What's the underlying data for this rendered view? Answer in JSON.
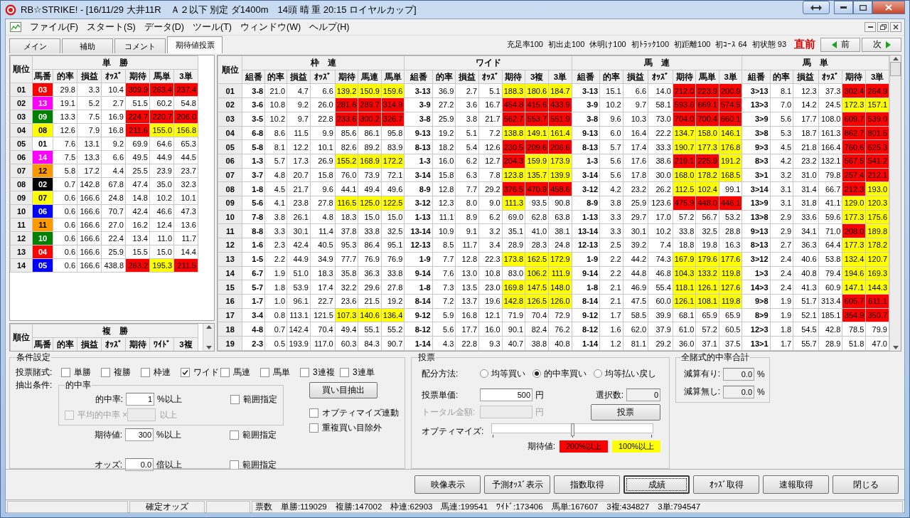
{
  "window": {
    "title": "RB☆STRIKE! - [16/11/29 大井11R　Ａ２以下 別定 ダ1400m　14頭 晴 重 20:15 ロイヤルカップ]"
  },
  "menu": [
    "ファイル(F)",
    "スタート(S)",
    "データ(D)",
    "ツール(T)",
    "ウィンドウ(W)",
    "ヘルプ(H)"
  ],
  "tabs": [
    {
      "label": "メイン",
      "selected": false
    },
    {
      "label": "補助",
      "selected": false
    },
    {
      "label": "コメント",
      "selected": false
    },
    {
      "label": "期待値投票",
      "selected": true
    }
  ],
  "stats": [
    "充足率100",
    "初出走100",
    "休明け100",
    "初ﾄﾗｯｸ100",
    "初距離100",
    "初ｺｰｽ 64",
    "初状態 93"
  ],
  "timing": "直前",
  "nav": {
    "prev": "前",
    "next": "次"
  },
  "win_table": {
    "rank_header": "順位",
    "title": "単　勝",
    "columns": [
      "馬番",
      "的率",
      "損益",
      "ｵｯｽﾞ",
      "期待",
      "馬単",
      "3単"
    ],
    "rows": [
      {
        "rank": "01",
        "cells": [
          {
            "text": "03",
            "color": "#ff0000"
          },
          "29.8",
          "3.3",
          "10.4",
          {
            "text": "309.9",
            "color": "#ff0000"
          },
          {
            "text": "263.4",
            "color": "#ff0000"
          },
          {
            "text": "237.4",
            "color": "#ff0000"
          }
        ]
      },
      {
        "rank": "02",
        "cells": [
          {
            "text": "13",
            "color": "#ff00ff"
          },
          "19.1",
          "5.2",
          "2.7",
          "51.5",
          "60.2",
          "54.8"
        ]
      },
      {
        "rank": "03",
        "cells": [
          {
            "text": "09",
            "color": "#008000"
          },
          "13.3",
          "7.5",
          "16.9",
          {
            "text": "224.7",
            "color": "#ff0000"
          },
          {
            "text": "220.7",
            "color": "#ff0000"
          },
          {
            "text": "206.0",
            "color": "#ff0000"
          }
        ]
      },
      {
        "rank": "04",
        "cells": [
          {
            "text": "08",
            "color": "#ffff00"
          },
          "12.6",
          "7.9",
          "16.8",
          {
            "text": "211.6",
            "color": "#ff0000"
          },
          {
            "text": "155.0",
            "color": "#ffff00"
          },
          {
            "text": "156.8",
            "color": "#ffff00"
          }
        ]
      },
      {
        "rank": "05",
        "cells": [
          {
            "text": "01",
            "color": "#ffffff"
          },
          "7.6",
          "13.1",
          "9.2",
          "69.9",
          "64.6",
          "65.3"
        ]
      },
      {
        "rank": "06",
        "cells": [
          {
            "text": "14",
            "color": "#ff00ff"
          },
          "7.5",
          "13.3",
          "6.6",
          "49.5",
          "44.9",
          "44.5"
        ]
      },
      {
        "rank": "07",
        "cells": [
          {
            "text": "12",
            "color": "#ff9900"
          },
          "5.8",
          "17.2",
          "4.4",
          "25.5",
          "23.9",
          "23.7"
        ]
      },
      {
        "rank": "08",
        "cells": [
          {
            "text": "02",
            "color": "#000000"
          },
          "0.7",
          "142.8",
          "67.8",
          "47.4",
          "35.0",
          "32.3"
        ]
      },
      {
        "rank": "09",
        "cells": [
          {
            "text": "07",
            "color": "#ffff00"
          },
          "0.6",
          "166.6",
          "24.8",
          "14.8",
          "10.2",
          "10.1"
        ]
      },
      {
        "rank": "10",
        "cells": [
          {
            "text": "06",
            "color": "#0000ff"
          },
          "0.6",
          "166.6",
          "70.7",
          "42.4",
          "46.6",
          "47.3"
        ]
      },
      {
        "rank": "11",
        "cells": [
          {
            "text": "11",
            "color": "#ff9900"
          },
          "0.6",
          "166.6",
          "27.0",
          "16.2",
          "12.4",
          "13.6"
        ]
      },
      {
        "rank": "12",
        "cells": [
          {
            "text": "10",
            "color": "#008000"
          },
          "0.6",
          "166.6",
          "22.4",
          "13.4",
          "11.0",
          "11.7"
        ]
      },
      {
        "rank": "13",
        "cells": [
          {
            "text": "04",
            "color": "#ff0000"
          },
          "0.6",
          "166.6",
          "25.9",
          "15.5",
          "15.0",
          "14.4"
        ]
      },
      {
        "rank": "14",
        "cells": [
          {
            "text": "05",
            "color": "#0000ff"
          },
          "0.6",
          "166.6",
          "438.8",
          {
            "text": "263.2",
            "color": "#ff0000"
          },
          {
            "text": "195.3",
            "color": "#ffff00"
          },
          {
            "text": "211.5",
            "color": "#ff0000"
          }
        ]
      }
    ]
  },
  "place_table": {
    "rank_header": "順位",
    "title": "複　勝",
    "columns": [
      "馬番",
      "的率",
      "損益",
      "ｵｯｽﾞ",
      "期待",
      "ﾜｲﾄﾞ",
      "3複"
    ]
  },
  "main_table": {
    "rank_header": "順位",
    "groups": [
      {
        "title": "枠　連",
        "columns": [
          "組番",
          "的率",
          "損益",
          "ｵｯｽﾞ",
          "期待",
          "馬連",
          "馬単"
        ]
      },
      {
        "title": "ワイド",
        "columns": [
          "組番",
          "的率",
          "損益",
          "ｵｯｽﾞ",
          "期待",
          "3複",
          "3単"
        ]
      },
      {
        "title": "馬　連",
        "columns": [
          "組番",
          "的率",
          "損益",
          "ｵｯｽﾞ",
          "期待",
          "馬単",
          "3単"
        ]
      },
      {
        "title": "馬　単",
        "columns": [
          "組番",
          "的率",
          "損益",
          "ｵｯｽﾞ",
          "期待",
          "3単"
        ]
      }
    ],
    "rows": [
      {
        "rank": "01",
        "cells": [
          "3-8",
          "21.0",
          "4.7",
          "6.6",
          {
            "text": "139.2",
            "color": "#ffff00"
          },
          {
            "text": "150.9",
            "color": "#ffff00"
          },
          {
            "text": "159.6",
            "color": "#ffff00"
          },
          "3-13",
          "36.9",
          "2.7",
          "5.1",
          {
            "text": "188.3",
            "color": "#ffff00"
          },
          {
            "text": "180.6",
            "color": "#ffff00"
          },
          {
            "text": "184.7",
            "color": "#ffff00"
          },
          "3-13",
          "15.1",
          "6.6",
          "14.0",
          {
            "text": "212.0",
            "color": "#ff0000"
          },
          {
            "text": "223.9",
            "color": "#ff0000"
          },
          {
            "text": "200.9",
            "color": "#ff0000"
          },
          "3>13",
          "8.1",
          "12.3",
          "37.3",
          {
            "text": "302.4",
            "color": "#ff0000"
          },
          {
            "text": "264.9",
            "color": "#ff0000"
          }
        ]
      },
      {
        "rank": "02",
        "cells": [
          "3-6",
          "10.8",
          "9.2",
          "26.0",
          {
            "text": "281.6",
            "color": "#ff0000"
          },
          {
            "text": "289.7",
            "color": "#ff0000"
          },
          {
            "text": "314.9",
            "color": "#ff0000"
          },
          "3-9",
          "27.2",
          "3.6",
          "16.7",
          {
            "text": "454.8",
            "color": "#ff0000"
          },
          {
            "text": "415.6",
            "color": "#ff0000"
          },
          {
            "text": "433.9",
            "color": "#ff0000"
          },
          "3-9",
          "10.2",
          "9.7",
          "58.1",
          {
            "text": "593.6",
            "color": "#ff0000"
          },
          {
            "text": "669.1",
            "color": "#ff0000"
          },
          {
            "text": "574.5",
            "color": "#ff0000"
          },
          "13>3",
          "7.0",
          "14.2",
          "24.5",
          {
            "text": "172.3",
            "color": "#ffff00"
          },
          {
            "text": "157.1",
            "color": "#ffff00"
          }
        ]
      },
      {
        "rank": "03",
        "cells": [
          "3-5",
          "10.2",
          "9.7",
          "22.8",
          {
            "text": "233.6",
            "color": "#ff0000"
          },
          {
            "text": "300.2",
            "color": "#ff0000"
          },
          {
            "text": "326.7",
            "color": "#ff0000"
          },
          "3-8",
          "25.9",
          "3.8",
          "21.7",
          {
            "text": "562.7",
            "color": "#ff0000"
          },
          {
            "text": "553.7",
            "color": "#ff0000"
          },
          {
            "text": "551.9",
            "color": "#ff0000"
          },
          "3-8",
          "9.6",
          "10.3",
          "73.0",
          {
            "text": "704.0",
            "color": "#ff0000"
          },
          {
            "text": "700.4",
            "color": "#ff0000"
          },
          {
            "text": "660.1",
            "color": "#ff0000"
          },
          "3>9",
          "5.6",
          "17.7",
          "108.0",
          {
            "text": "609.7",
            "color": "#ff0000"
          },
          {
            "text": "539.0",
            "color": "#ff0000"
          }
        ]
      },
      {
        "rank": "04",
        "cells": [
          "6-8",
          "8.6",
          "11.5",
          "9.9",
          "85.6",
          "86.1",
          "95.8",
          "9-13",
          "19.2",
          "5.1",
          "7.2",
          {
            "text": "138.8",
            "color": "#ffff00"
          },
          {
            "text": "149.1",
            "color": "#ffff00"
          },
          {
            "text": "161.4",
            "color": "#ffff00"
          },
          "9-13",
          "6.0",
          "16.4",
          "22.2",
          {
            "text": "134.7",
            "color": "#ffff00"
          },
          {
            "text": "158.0",
            "color": "#ffff00"
          },
          {
            "text": "146.1",
            "color": "#ffff00"
          },
          "3>8",
          "5.3",
          "18.7",
          "161.3",
          {
            "text": "862.7",
            "color": "#ff0000"
          },
          {
            "text": "801.5",
            "color": "#ff0000"
          }
        ]
      },
      {
        "rank": "05",
        "cells": [
          "5-8",
          "8.1",
          "12.2",
          "10.1",
          "82.6",
          "89.2",
          "83.9",
          "8-13",
          "18.2",
          "5.4",
          "12.6",
          {
            "text": "230.5",
            "color": "#ff0000"
          },
          {
            "text": "209.6",
            "color": "#ff0000"
          },
          {
            "text": "206.6",
            "color": "#ff0000"
          },
          "8-13",
          "5.7",
          "17.4",
          "33.3",
          {
            "text": "190.7",
            "color": "#ffff00"
          },
          {
            "text": "177.3",
            "color": "#ffff00"
          },
          {
            "text": "176.8",
            "color": "#ffff00"
          },
          "9>3",
          "4.5",
          "21.8",
          "166.4",
          {
            "text": "760.6",
            "color": "#ff0000"
          },
          {
            "text": "625.3",
            "color": "#ff0000"
          }
        ]
      },
      {
        "rank": "06",
        "cells": [
          "1-3",
          "5.7",
          "17.3",
          "26.9",
          {
            "text": "155.2",
            "color": "#ffff00"
          },
          {
            "text": "168.9",
            "color": "#ffff00"
          },
          {
            "text": "172.2",
            "color": "#ffff00"
          },
          "1-3",
          "16.0",
          "6.2",
          "12.7",
          {
            "text": "204.3",
            "color": "#ff0000"
          },
          {
            "text": "159.9",
            "color": "#ffff00"
          },
          {
            "text": "173.9",
            "color": "#ffff00"
          },
          "1-3",
          "5.6",
          "17.6",
          "38.6",
          {
            "text": "219.1",
            "color": "#ff0000"
          },
          {
            "text": "225.9",
            "color": "#ff0000"
          },
          {
            "text": "191.2",
            "color": "#ffff00"
          },
          "8>3",
          "4.2",
          "23.2",
          "132.1",
          {
            "text": "567.5",
            "color": "#ff0000"
          },
          {
            "text": "541.2",
            "color": "#ff0000"
          }
        ]
      },
      {
        "rank": "07",
        "cells": [
          "3-7",
          "4.8",
          "20.7",
          "15.8",
          "76.0",
          "73.9",
          "72.1",
          "3-14",
          "15.8",
          "6.3",
          "7.8",
          {
            "text": "123.8",
            "color": "#ffff00"
          },
          {
            "text": "135.7",
            "color": "#ffff00"
          },
          {
            "text": "139.9",
            "color": "#ffff00"
          },
          "3-14",
          "5.6",
          "17.8",
          "30.0",
          {
            "text": "168.0",
            "color": "#ffff00"
          },
          {
            "text": "178.2",
            "color": "#ffff00"
          },
          {
            "text": "168.5",
            "color": "#ffff00"
          },
          "3>1",
          "3.2",
          "31.0",
          "79.8",
          {
            "text": "257.4",
            "color": "#ff0000"
          },
          {
            "text": "212.1",
            "color": "#ff0000"
          }
        ]
      },
      {
        "rank": "08",
        "cells": [
          "1-8",
          "4.5",
          "21.7",
          "9.6",
          "44.1",
          "49.4",
          "49.6",
          "8-9",
          "12.8",
          "7.7",
          "29.2",
          {
            "text": "376.5",
            "color": "#ff0000"
          },
          {
            "text": "470.9",
            "color": "#ff0000"
          },
          {
            "text": "458.6",
            "color": "#ff0000"
          },
          "3-12",
          "4.2",
          "23.2",
          "26.2",
          {
            "text": "112.5",
            "color": "#ffff00"
          },
          {
            "text": "102.4",
            "color": "#ffff00"
          },
          "99.1",
          "3>14",
          "3.1",
          "31.4",
          "66.7",
          {
            "text": "212.3",
            "color": "#ff0000"
          },
          {
            "text": "193.0",
            "color": "#ffff00"
          }
        ]
      },
      {
        "rank": "09",
        "cells": [
          "5-6",
          "4.1",
          "23.8",
          "27.8",
          {
            "text": "116.5",
            "color": "#ffff00"
          },
          {
            "text": "125.0",
            "color": "#ffff00"
          },
          {
            "text": "122.5",
            "color": "#ffff00"
          },
          "3-12",
          "12.3",
          "8.0",
          "9.0",
          {
            "text": "111.3",
            "color": "#ffff00"
          },
          "93.5",
          "90.8",
          "8-9",
          "3.8",
          "25.9",
          "123.6",
          {
            "text": "475.9",
            "color": "#ff0000"
          },
          {
            "text": "448.0",
            "color": "#ff0000"
          },
          {
            "text": "446.1",
            "color": "#ff0000"
          },
          "13>9",
          "3.1",
          "31.8",
          "41.1",
          {
            "text": "129.0",
            "color": "#ffff00"
          },
          {
            "text": "120.3",
            "color": "#ffff00"
          }
        ]
      },
      {
        "rank": "10",
        "cells": [
          "7-8",
          "3.8",
          "26.1",
          "4.8",
          "18.3",
          "15.0",
          "15.0",
          "1-13",
          "11.1",
          "8.9",
          "6.2",
          "69.0",
          "62.8",
          "63.8",
          "1-13",
          "3.3",
          "29.7",
          "17.0",
          "57.2",
          "56.7",
          "53.2",
          "13>8",
          "2.9",
          "33.6",
          "59.6",
          {
            "text": "177.3",
            "color": "#ffff00"
          },
          {
            "text": "175.6",
            "color": "#ffff00"
          }
        ]
      },
      {
        "rank": "11",
        "cells": [
          "8-8",
          "3.3",
          "30.1",
          "11.4",
          "37.8",
          "33.8",
          "32.5",
          "13-14",
          "10.9",
          "9.1",
          "3.2",
          "35.1",
          "41.0",
          "38.1",
          "13-14",
          "3.3",
          "30.1",
          "10.2",
          "33.8",
          "32.5",
          "28.8",
          "9>13",
          "2.9",
          "34.1",
          "71.0",
          {
            "text": "208.0",
            "color": "#ff0000"
          },
          {
            "text": "189.8",
            "color": "#ffff00"
          }
        ]
      },
      {
        "rank": "12",
        "cells": [
          "1-6",
          "2.3",
          "42.4",
          "40.5",
          "95.3",
          "86.4",
          "95.1",
          "12-13",
          "8.5",
          "11.7",
          "3.4",
          "28.9",
          "28.3",
          "24.8",
          "12-13",
          "2.5",
          "39.2",
          "7.4",
          "18.8",
          "19.8",
          "16.3",
          "8>13",
          "2.7",
          "36.3",
          "64.4",
          {
            "text": "177.3",
            "color": "#ffff00"
          },
          {
            "text": "178.2",
            "color": "#ffff00"
          }
        ]
      },
      {
        "rank": "13",
        "cells": [
          "1-5",
          "2.2",
          "44.9",
          "34.9",
          "77.7",
          "76.9",
          "76.9",
          "1-9",
          "7.7",
          "12.8",
          "22.3",
          {
            "text": "173.8",
            "color": "#ffff00"
          },
          {
            "text": "162.5",
            "color": "#ffff00"
          },
          {
            "text": "172.9",
            "color": "#ffff00"
          },
          "1-9",
          "2.2",
          "44.2",
          "74.3",
          {
            "text": "167.9",
            "color": "#ffff00"
          },
          {
            "text": "179.6",
            "color": "#ffff00"
          },
          {
            "text": "177.6",
            "color": "#ffff00"
          },
          "3>12",
          "2.4",
          "40.6",
          "53.8",
          {
            "text": "132.4",
            "color": "#ffff00"
          },
          {
            "text": "120.7",
            "color": "#ffff00"
          }
        ]
      },
      {
        "rank": "14",
        "cells": [
          "6-7",
          "1.9",
          "51.0",
          "18.3",
          "35.8",
          "36.3",
          "33.8",
          "9-14",
          "7.6",
          "13.0",
          "10.8",
          "83.0",
          {
            "text": "106.2",
            "color": "#ffff00"
          },
          {
            "text": "111.9",
            "color": "#ffff00"
          },
          "9-14",
          "2.2",
          "44.8",
          "46.8",
          {
            "text": "104.3",
            "color": "#ffff00"
          },
          {
            "text": "133.2",
            "color": "#ffff00"
          },
          {
            "text": "119.8",
            "color": "#ffff00"
          },
          "1>3",
          "2.4",
          "40.8",
          "79.4",
          {
            "text": "194.6",
            "color": "#ffff00"
          },
          {
            "text": "169.3",
            "color": "#ffff00"
          }
        ]
      },
      {
        "rank": "15",
        "cells": [
          "5-7",
          "1.8",
          "53.9",
          "17.4",
          "32.2",
          "29.6",
          "27.8",
          "1-8",
          "7.3",
          "13.5",
          "23.0",
          {
            "text": "169.8",
            "color": "#ffff00"
          },
          {
            "text": "147.5",
            "color": "#ffff00"
          },
          {
            "text": "148.0",
            "color": "#ffff00"
          },
          "1-8",
          "2.1",
          "46.9",
          "55.4",
          {
            "text": "118.1",
            "color": "#ffff00"
          },
          {
            "text": "126.1",
            "color": "#ffff00"
          },
          {
            "text": "127.6",
            "color": "#ffff00"
          },
          "14>3",
          "2.4",
          "41.3",
          "60.9",
          {
            "text": "147.1",
            "color": "#ffff00"
          },
          {
            "text": "144.3",
            "color": "#ffff00"
          }
        ]
      },
      {
        "rank": "16",
        "cells": [
          "1-7",
          "1.0",
          "96.1",
          "22.7",
          "23.6",
          "21.5",
          "19.2",
          "8-14",
          "7.2",
          "13.7",
          "19.6",
          {
            "text": "142.8",
            "color": "#ffff00"
          },
          {
            "text": "126.5",
            "color": "#ffff00"
          },
          {
            "text": "126.0",
            "color": "#ffff00"
          },
          "8-14",
          "2.1",
          "47.5",
          "60.0",
          {
            "text": "126.1",
            "color": "#ffff00"
          },
          {
            "text": "108.1",
            "color": "#ffff00"
          },
          {
            "text": "119.8",
            "color": "#ffff00"
          },
          "9>8",
          "1.9",
          "51.7",
          "313.4",
          {
            "text": "605.7",
            "color": "#ff0000"
          },
          {
            "text": "611.1",
            "color": "#ff0000"
          }
        ]
      },
      {
        "rank": "17",
        "cells": [
          "3-4",
          "0.8",
          "113.1",
          "121.5",
          {
            "text": "107.3",
            "color": "#ffff00"
          },
          {
            "text": "140.6",
            "color": "#ffff00"
          },
          {
            "text": "136.4",
            "color": "#ffff00"
          },
          "9-12",
          "5.9",
          "16.8",
          "12.1",
          "71.9",
          "70.4",
          "72.9",
          "9-12",
          "1.7",
          "58.5",
          "39.9",
          "68.1",
          "65.9",
          "65.9",
          "8>9",
          "1.9",
          "52.1",
          "185.1",
          {
            "text": "354.9",
            "color": "#ff0000"
          },
          {
            "text": "350.7",
            "color": "#ff0000"
          }
        ]
      },
      {
        "rank": "18",
        "cells": [
          "4-8",
          "0.7",
          "142.4",
          "70.4",
          "49.4",
          "55.1",
          "55.2",
          "8-12",
          "5.6",
          "17.7",
          "16.0",
          "90.1",
          "82.4",
          "76.2",
          "8-12",
          "1.6",
          "62.0",
          "37.9",
          "61.0",
          "57.2",
          "60.5",
          "12>3",
          "1.8",
          "54.5",
          "42.8",
          "78.5",
          "79.9"
        ]
      },
      {
        "rank": "19",
        "cells": [
          "2-3",
          "0.5",
          "193.9",
          "117.0",
          "60.3",
          "84.3",
          "90.7",
          "1-14",
          "4.3",
          "22.8",
          "9.3",
          "40.7",
          "38.8",
          "40.8",
          "1-14",
          "1.2",
          "81.1",
          "29.2",
          "36.0",
          "37.1",
          "37.5",
          "13>1",
          "1.7",
          "55.7",
          "28.9",
          "51.8",
          "47.0"
        ]
      }
    ]
  },
  "conditions": {
    "title": "条件設定",
    "bet_label": "投票賭式:",
    "bet_types": [
      {
        "label": "単勝",
        "checked": false
      },
      {
        "label": "複勝",
        "checked": false
      },
      {
        "label": "枠連",
        "checked": false
      },
      {
        "label": "ワイド",
        "checked": true
      },
      {
        "label": "馬連",
        "checked": false
      },
      {
        "label": "馬単",
        "checked": false
      },
      {
        "label": "3連複",
        "checked": false
      },
      {
        "label": "3連単",
        "checked": false
      }
    ],
    "extract_label": "抽出条件:",
    "hit_group": {
      "title": "的中率",
      "field": {
        "label": "的中率:",
        "value": "1",
        "unit": "%以上",
        "range": {
          "label": "範囲指定",
          "checked": false
        }
      },
      "average": {
        "label": "平均的中率 ×",
        "checked": false,
        "disabled": true,
        "unit": "以上"
      }
    },
    "fields": [
      {
        "label": "期待値:",
        "value": "300",
        "unit": "%以上",
        "range": {
          "label": "範囲指定",
          "checked": false
        }
      },
      {
        "label": "オッズ:",
        "value": "0.0",
        "unit": "倍以上",
        "range": {
          "label": "範囲指定",
          "checked": false
        }
      }
    ],
    "extract_button": "買い目抽出",
    "options": [
      {
        "label": "オプティマイズ連動",
        "checked": false
      },
      {
        "label": "重複買い目除外",
        "checked": false
      }
    ]
  },
  "vote": {
    "title": "投票",
    "method_label": "配分方法:",
    "methods": [
      {
        "label": "均等買い",
        "selected": false
      },
      {
        "label": "的中率買い",
        "selected": true
      },
      {
        "label": "均等払い戻し",
        "selected": false
      }
    ],
    "unit_price": {
      "label": "投票単価:",
      "value": "500",
      "unit": "円"
    },
    "count": {
      "label": "選択数:",
      "value": "0"
    },
    "total": {
      "label": "トータル金額:",
      "unit": "円",
      "disabled": true
    },
    "vote_button": "投票",
    "optimize": {
      "label": "オプティマイズ:",
      "level": 0.5
    },
    "legend_label": "期待値:",
    "legend": [
      {
        "label": "200%以上",
        "color": "#ff0000"
      },
      {
        "label": "100%以上",
        "color": "#ffff00"
      }
    ]
  },
  "totals": {
    "title": "全賭式的中率合計",
    "rows": [
      {
        "label": "減算有り:",
        "value": "0.0",
        "unit": "%"
      },
      {
        "label": "減算無し:",
        "value": "0.0",
        "unit": "%"
      }
    ]
  },
  "buttons": [
    {
      "label": "映像表示",
      "focused": false
    },
    {
      "label": "予測ｵｯｽﾞ表示",
      "focused": false
    },
    {
      "label": "指数取得",
      "focused": false
    },
    {
      "label": "成績",
      "focused": true
    },
    {
      "label": "ｵｯｽﾞ取得",
      "focused": false
    },
    {
      "label": "速報取得",
      "focused": false
    },
    {
      "label": "閉じる",
      "focused": false
    }
  ],
  "status_bar": {
    "mode": "確定オッズ",
    "votes": "票数　単勝:119029　複勝:147002　枠連:62903　馬連:199541　ﾜｲﾄﾞ:173406　馬単:167607　3複:434827　3単:794547"
  }
}
